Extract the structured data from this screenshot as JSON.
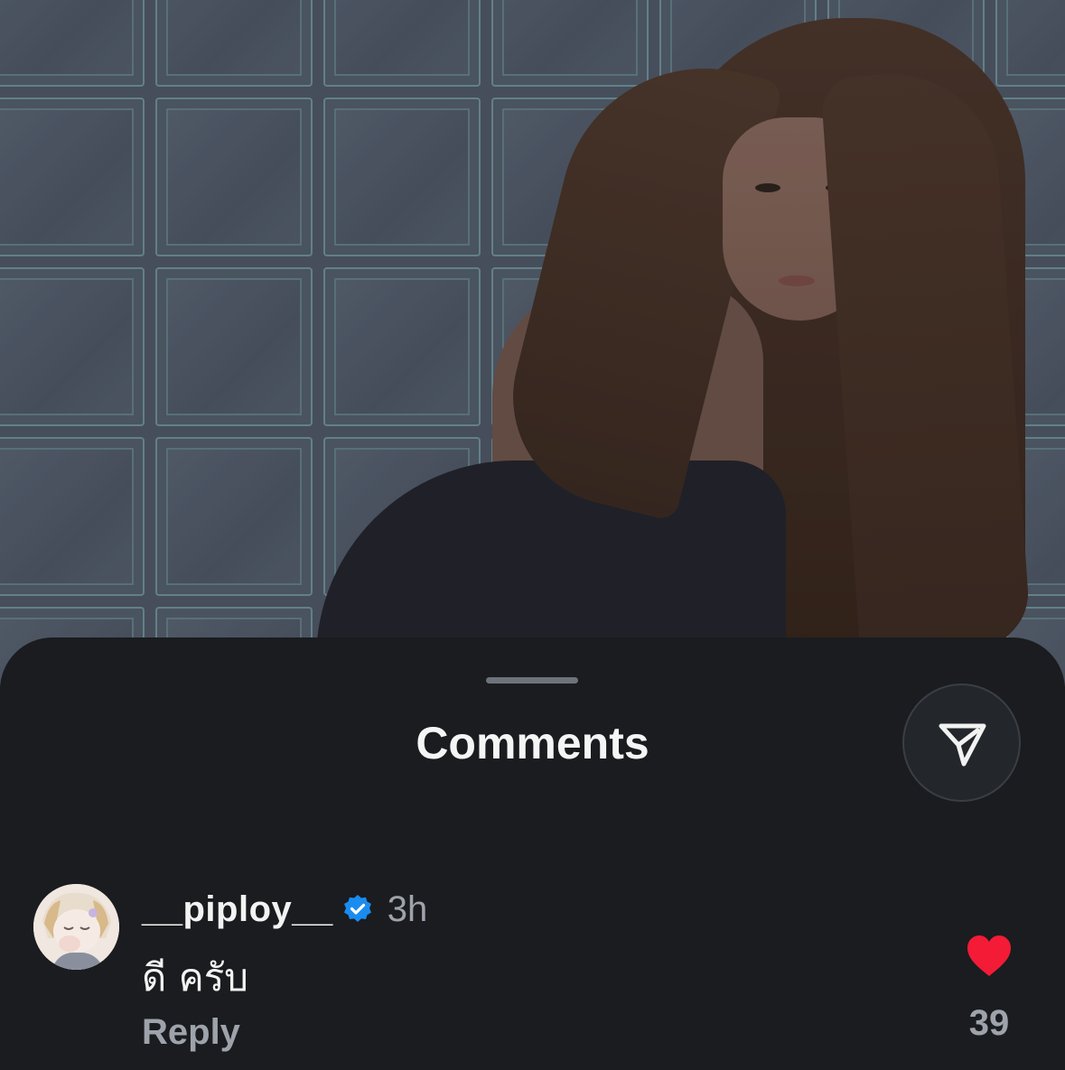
{
  "sheet": {
    "title": "Comments"
  },
  "comment": {
    "username": "__piploy__",
    "time": "3h",
    "text": "ดี ครับ",
    "reply_label": "Reply",
    "like_count": "39"
  },
  "colors": {
    "sheet_bg": "#1a1c1f",
    "like_heart": "#f31b36",
    "verified_badge": "#1a8cf0",
    "muted_text": "#9ea3ab"
  },
  "icons": {
    "share": "paper-plane-icon",
    "verified": "verified-badge-icon",
    "like": "heart-icon"
  }
}
